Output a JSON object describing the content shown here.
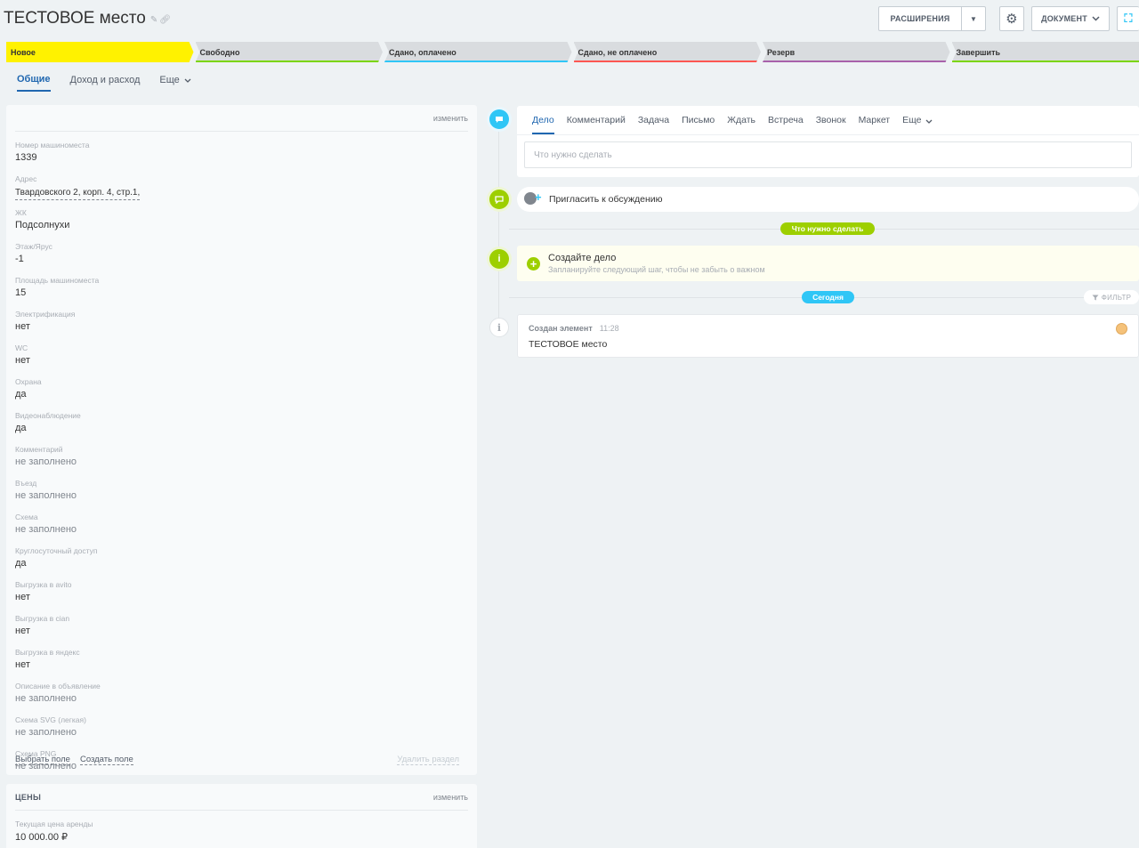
{
  "header": {
    "title": "ТЕСТОВОЕ место",
    "extensions_label": "РАСШИРЕНИЯ",
    "document_label": "ДОКУМЕНТ"
  },
  "stages": [
    {
      "label": "Новое",
      "color": "#fff200",
      "active": true
    },
    {
      "label": "Свободно",
      "color": "#7bd500"
    },
    {
      "label": "Сдано, оплачено",
      "color": "#2fc6f6"
    },
    {
      "label": "Сдано, не оплачено",
      "color": "#ff5752"
    },
    {
      "label": "Резерв",
      "color": "#a861ab"
    },
    {
      "label": "Завершить",
      "color": "#7bd500"
    }
  ],
  "tabs": [
    "Общие",
    "Доход и расход",
    "Еще"
  ],
  "main_card": {
    "edit_label": "изменить",
    "fields": [
      {
        "label": "Номер машиноместа",
        "value": "1339"
      },
      {
        "label": "Адрес",
        "value": "Твардовского 2, корп. 4, стр.1,",
        "link": true
      },
      {
        "label": "ЖК",
        "value": "Подсолнухи"
      },
      {
        "label": "Этаж/Ярус",
        "value": "-1"
      },
      {
        "label": "Площадь машиноместа",
        "value": "15"
      },
      {
        "label": "Электрификация",
        "value": "нет"
      },
      {
        "label": "WC",
        "value": "нет"
      },
      {
        "label": "Охрана",
        "value": "да"
      },
      {
        "label": "Видеонаблюдение",
        "value": "да"
      },
      {
        "label": "Комментарий",
        "value": "не заполнено",
        "empty": true
      },
      {
        "label": "Въезд",
        "value": "не заполнено",
        "empty": true
      },
      {
        "label": "Схема",
        "value": "не заполнено",
        "empty": true
      },
      {
        "label": "Круглосуточный доступ",
        "value": "да"
      },
      {
        "label": "Выгрузка в avito",
        "value": "нет"
      },
      {
        "label": "Выгрузка в cian",
        "value": "нет"
      },
      {
        "label": "Выгрузка в яндекс",
        "value": "нет"
      },
      {
        "label": "Описание в объявление",
        "value": "не заполнено",
        "empty": true
      },
      {
        "label": "Схема SVG (легкая)",
        "value": "не заполнено",
        "empty": true
      },
      {
        "label": "Схема PNG",
        "value": "не заполнено",
        "empty": true
      }
    ],
    "select_field": "Выбрать поле",
    "create_field": "Создать поле",
    "delete_section": "Удалить раздел"
  },
  "prices_card": {
    "title": "ЦЕНЫ",
    "edit_label": "изменить",
    "fields": [
      {
        "label": "Текущая цена аренды",
        "value": "10 000.00 ₽"
      }
    ]
  },
  "composer": {
    "tabs": [
      "Дело",
      "Комментарий",
      "Задача",
      "Письмо",
      "Ждать",
      "Встреча",
      "Звонок",
      "Маркет",
      "Еще"
    ],
    "placeholder": "Что нужно сделать"
  },
  "invite_label": "Пригласить к обсуждению",
  "todo_pill": "Что нужно сделать",
  "create_task": {
    "title": "Создайте дело",
    "subtitle": "Запланируйте следующий шаг, чтобы не забыть о важном"
  },
  "today_pill": "Сегодня",
  "filter_label": "ФИЛЬТР",
  "created_event": {
    "title": "Создан элемент",
    "time": "11:28",
    "body": "ТЕСТОВОЕ место"
  }
}
